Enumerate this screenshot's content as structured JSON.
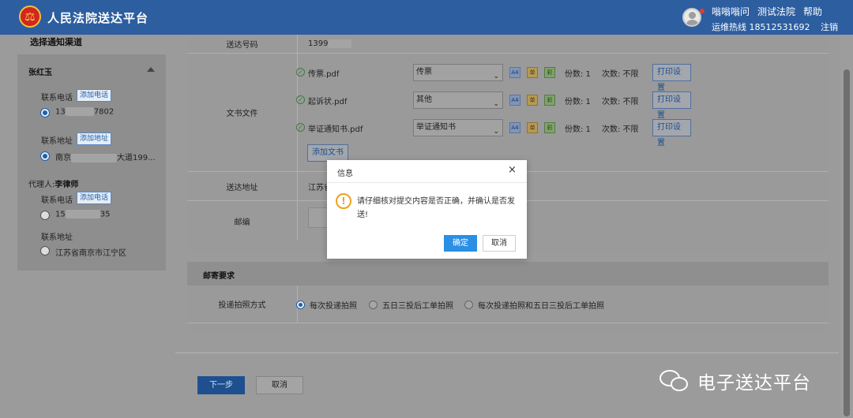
{
  "header": {
    "title": "人民法院送达平台",
    "user_name": "嗡嗡嗡问",
    "court": "测试法院",
    "help": "帮助",
    "hotline_label": "运维热线",
    "hotline": "18512531692",
    "logout": "注销",
    "logo_glyph": "⚖"
  },
  "left": {
    "section_title": "选择通知渠道",
    "party": {
      "name": "张红玉",
      "phone_label": "联系电话",
      "add_phone": "添加电话",
      "phone_prefix": "13",
      "phone_suffix": "7802",
      "address_label": "联系地址",
      "add_address": "添加地址",
      "address_prefix": "南京",
      "address_suffix": "大道199..."
    },
    "agent": {
      "label": "代理人:",
      "name": "李律师",
      "phone_label": "联系电话",
      "add_phone": "添加电话",
      "phone_prefix": "15",
      "phone_suffix": "35",
      "address_label": "联系地址",
      "address": "江苏省南京市江宁区"
    }
  },
  "form": {
    "service_no_label": "送达号码",
    "service_no_prefix": "1399",
    "documents_label": "文书文件",
    "documents": [
      {
        "file": "传票.pdf",
        "type": "传票",
        "copies": "份数: 1",
        "times": "次数: 不限",
        "print": "打印设置"
      },
      {
        "file": "起诉状.pdf",
        "type": "其他",
        "copies": "份数: 1",
        "times": "次数: 不限",
        "print": "打印设置"
      },
      {
        "file": "举证通知书.pdf",
        "type": "举证通知书",
        "copies": "份数: 1",
        "times": "次数: 不限",
        "print": "打印设置"
      }
    ],
    "tag_a4": "A4",
    "tag_bw": "单",
    "tag_color": "彩",
    "add_document": "添加文书",
    "address_label": "送达地址",
    "address_value": "江苏省南",
    "postcode_label": "邮编"
  },
  "mail": {
    "title": "邮寄要求",
    "photo_label": "投递拍照方式",
    "options": [
      "每次投递拍照",
      "五日三投后工单拍照",
      "每次投递拍照和五日三投后工单拍照"
    ],
    "selected": "每次投递拍照"
  },
  "footer": {
    "next": "下一步",
    "cancel": "取消"
  },
  "watermark": "电子送达平台",
  "dialog": {
    "title": "信息",
    "message": "请仔细核对提交内容是否正确，并确认是否发送!",
    "ok": "确定",
    "cancel": "取消",
    "warn_glyph": "!",
    "close_glyph": "×"
  }
}
